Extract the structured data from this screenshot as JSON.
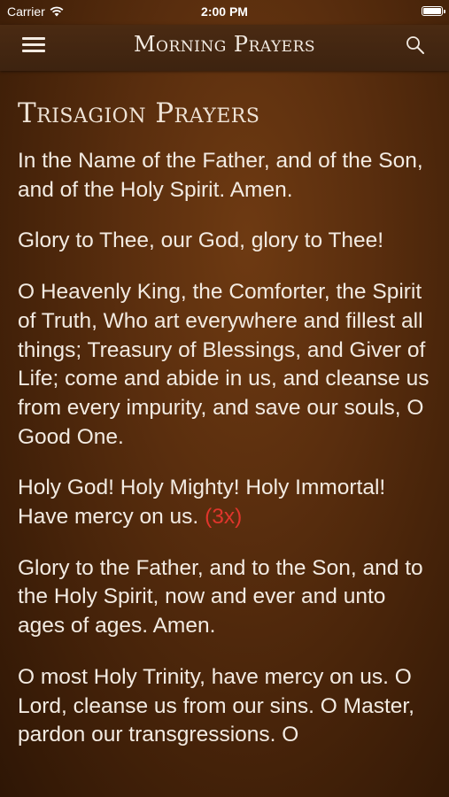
{
  "status_bar": {
    "carrier": "Carrier",
    "time": "2:00 PM"
  },
  "nav": {
    "title": "Morning Prayers",
    "menu_icon": "hamburger-menu-icon",
    "search_icon": "search-icon"
  },
  "section": {
    "title": "Trisagion Prayers",
    "paragraphs": [
      "In the Name of the Father, and of the Son, and of the Holy Spirit. Amen.",
      "Glory to Thee, our God, glory to Thee!",
      "O Heavenly King, the Comforter, the Spirit of Truth, Who art everywhere and fillest all things; Treasury of Blessings, and Giver of Life; come and abide in us, and cleanse us from every impurity, and save our souls, O Good One.",
      "Holy God! Holy Mighty! Holy Immortal! Have mercy on us.",
      "Glory to the Father, and to the Son, and to the Holy Spirit, now and ever and unto ages of ages. Amen.",
      "O most Holy Trinity, have mercy on us. O Lord, cleanse us from our sins. O Master, pardon our transgressions. O"
    ],
    "rubric_repeat": "(3x)"
  },
  "colors": {
    "background": "#5a2e0e",
    "text": "#f3ebe2",
    "rubric": "#e0352c"
  }
}
